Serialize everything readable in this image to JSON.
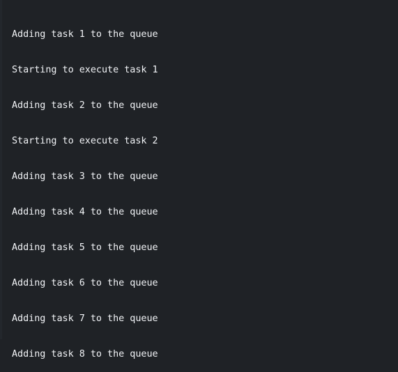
{
  "console": {
    "lines": [
      "Adding task 1 to the queue",
      "Starting to execute task 1",
      "Adding task 2 to the queue",
      "Starting to execute task 2",
      "Adding task 3 to the queue",
      "Adding task 4 to the queue",
      "Adding task 5 to the queue",
      "Adding task 6 to the queue",
      "Adding task 7 to the queue",
      "Adding task 8 to the queue"
    ]
  },
  "colors": {
    "background": "#1f2226",
    "text": "#f2f4f7"
  }
}
